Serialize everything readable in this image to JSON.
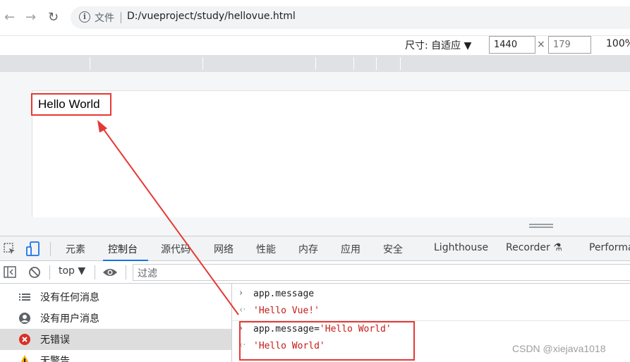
{
  "browser": {
    "file_label": "文件",
    "url": "D:/vueproject/study/hellovue.html"
  },
  "device_toolbar": {
    "dimensions_label": "尺寸: 自适应 ▼",
    "width_value": "1440",
    "height_placeholder": "179",
    "times": "×",
    "zoom": "100%"
  },
  "page": {
    "hello_text": "Hello World"
  },
  "devtools": {
    "tabs": [
      {
        "label": "元素"
      },
      {
        "label": "控制台"
      },
      {
        "label": "源代码"
      },
      {
        "label": "网络"
      },
      {
        "label": "性能"
      },
      {
        "label": "内存"
      },
      {
        "label": "应用"
      },
      {
        "label": "安全"
      },
      {
        "label": "Lighthouse"
      },
      {
        "label": "Recorder ⚗"
      },
      {
        "label": "Performa"
      }
    ],
    "active_tab": "控制台",
    "console_toolbar": {
      "context": "top ▼",
      "filter_placeholder": "过滤"
    },
    "sidebar": [
      {
        "label": "没有任何消息",
        "icon": "list-icon"
      },
      {
        "label": "没有用户消息",
        "icon": "user-icon"
      },
      {
        "label": "无错误",
        "icon": "error-icon"
      },
      {
        "label": "无警告",
        "icon": "warning-icon"
      }
    ],
    "console_lines": [
      {
        "kind": "input",
        "code": "app.message",
        "string": ""
      },
      {
        "kind": "result",
        "code": "",
        "string": "'Hello Vue!'"
      },
      {
        "kind": "input",
        "code": "app.message=",
        "string": "'Hello World'"
      },
      {
        "kind": "result",
        "code": "",
        "string": "'Hello World'"
      }
    ]
  },
  "watermark": "CSDN @xiejava1018",
  "colors": {
    "accent": "#1a73e8",
    "annotation": "#e53935",
    "string": "#c41a16",
    "error": "#d93025",
    "warning": "#f9ab00"
  }
}
